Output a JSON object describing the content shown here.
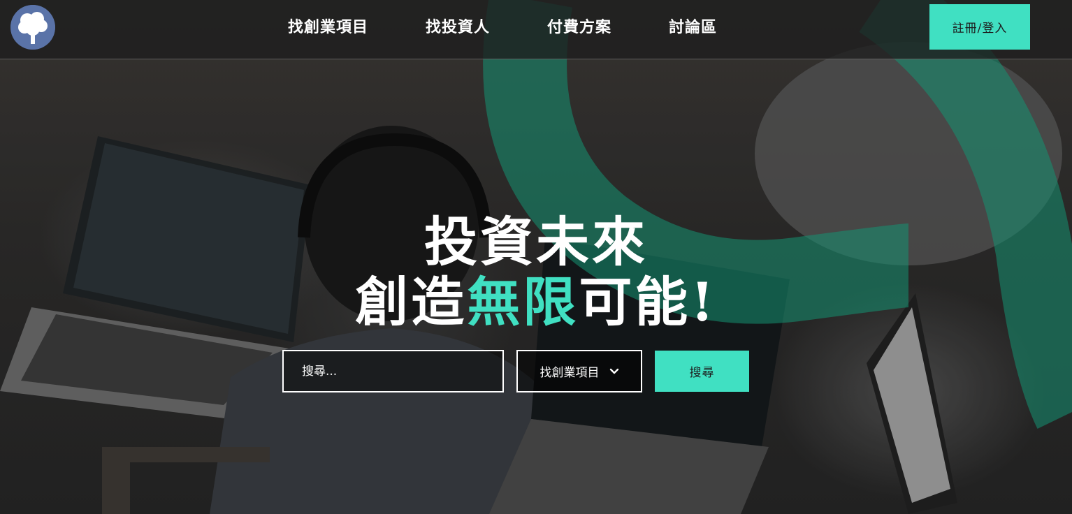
{
  "header": {
    "logo_icon": "tree-logo-icon",
    "nav": [
      {
        "label": "找創業項目"
      },
      {
        "label": "找投資人"
      },
      {
        "label": "付費方案"
      },
      {
        "label": "討論區"
      }
    ],
    "auth_label": "註冊/登入"
  },
  "hero": {
    "headline_line1": "投資未來",
    "headline_line2_prefix": "創造",
    "headline_line2_accent": "無限",
    "headline_line2_suffix": "可能!",
    "search": {
      "placeholder": "搜尋...",
      "category_selected": "找創業項目",
      "category_icon": "chevron-down-icon",
      "button_label": "搜尋"
    }
  },
  "colors": {
    "accent": "#40e0c2",
    "header_bg": "#1e1e1e",
    "text": "#ffffff"
  }
}
